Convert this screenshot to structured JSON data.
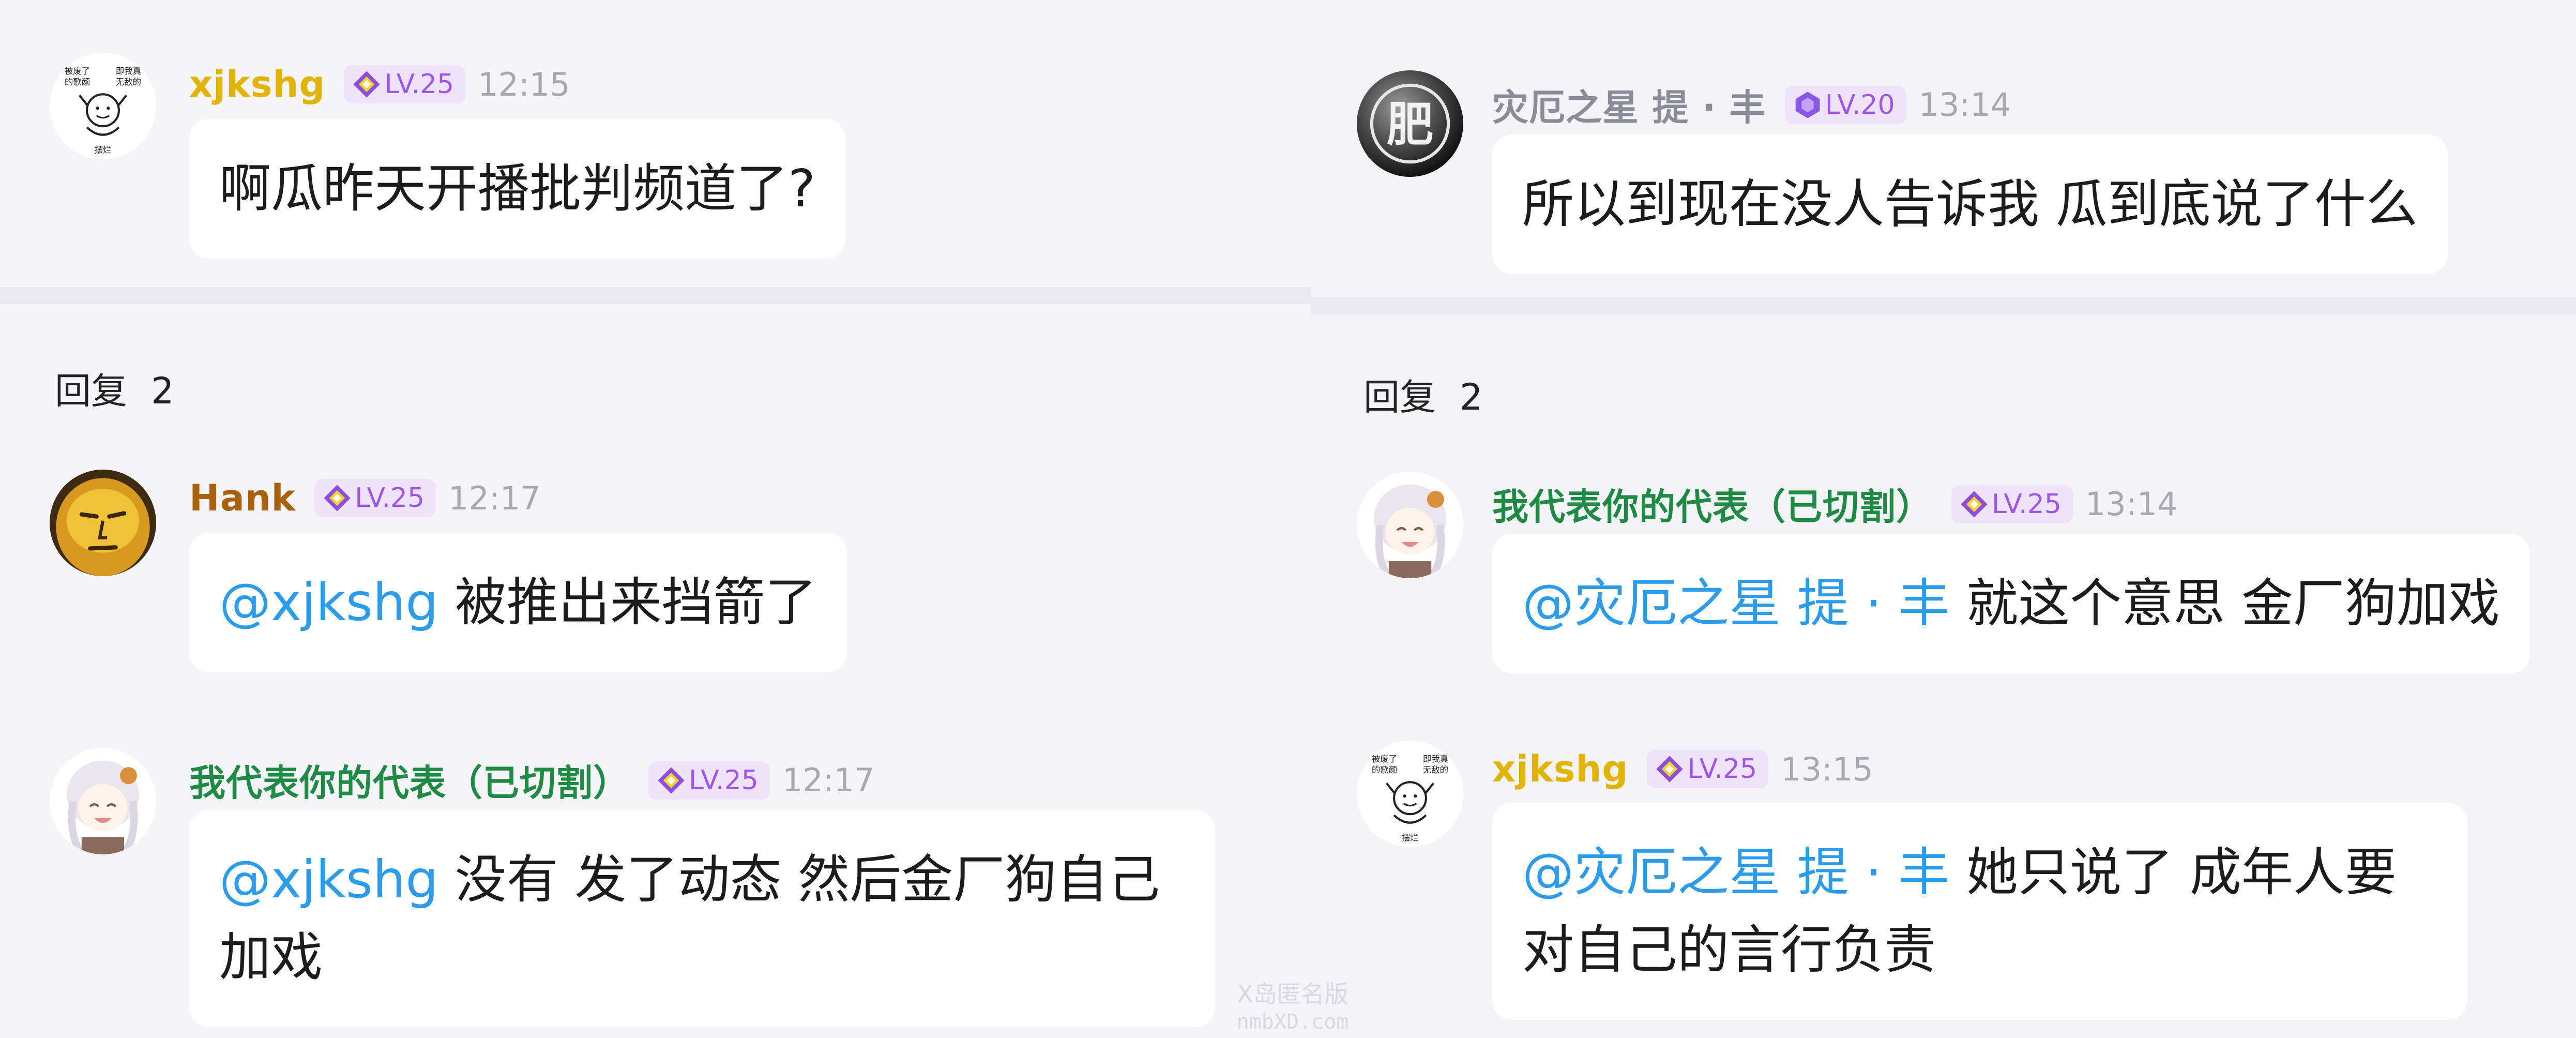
{
  "colors": {
    "gold_name": "#e0b400",
    "brown_name": "#a8620c",
    "green_name": "#1f8a43",
    "gray_name": "#8c8c99",
    "mention": "#2b9bea",
    "level_text": "#9f55e6",
    "level_bg": "#efe3fb"
  },
  "left": {
    "op": {
      "username": "xjkshg",
      "level": "LV.25",
      "time": "12:15",
      "text": "啊瓜昨天开播批判频道了?",
      "avatar_text": [
        "被废了",
        "的歌颜",
        "即我真",
        "无敌的",
        "摆烂"
      ]
    },
    "replies_label": "回复",
    "replies_count": "2",
    "replies": [
      {
        "username": "Hank",
        "level": "LV.25",
        "time": "12:17",
        "mention": "@xjkshg",
        "text": " 被推出来挡箭了"
      },
      {
        "username": "我代表你的代表（已切割）",
        "level": "LV.25",
        "time": "12:17",
        "mention": "@xjkshg",
        "text": " 没有 发了动态 然后金厂狗自己加戏"
      }
    ]
  },
  "right": {
    "op": {
      "username": "灾厄之星 提 · 丰",
      "level": "LV.20",
      "time": "13:14",
      "text": "所以到现在没人告诉我 瓜到底说了什么",
      "avatar_glyph": "肥"
    },
    "replies_label": "回复",
    "replies_count": "2",
    "replies": [
      {
        "username": "我代表你的代表（已切割）",
        "level": "LV.25",
        "time": "13:14",
        "mention": "@灾厄之星 提 · 丰",
        "text": " 就这个意思 金厂狗加戏"
      },
      {
        "username": "xjkshg",
        "level": "LV.25",
        "time": "13:15",
        "mention": "@灾厄之星 提 · 丰",
        "text": " 她只说了 成年人要对自己的言行负责",
        "avatar_text": [
          "被废了",
          "的歌颜",
          "即我真",
          "无敌的",
          "摆烂"
        ]
      }
    ]
  },
  "watermark": {
    "line1": "X岛匿名版",
    "line2": "nmbXD.com"
  }
}
